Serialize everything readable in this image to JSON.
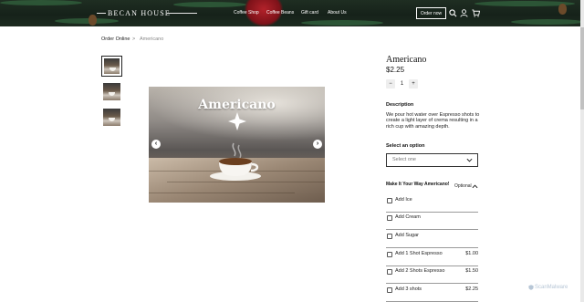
{
  "header": {
    "logo": "BECAN HOUSE",
    "nav": [
      {
        "label": "Coffee Shop"
      },
      {
        "label": "Coffee Beans"
      },
      {
        "label": "Gift card"
      },
      {
        "label": "About Us"
      }
    ],
    "order_button": "Order now",
    "icons": [
      "search-icon",
      "account-icon",
      "cart-icon"
    ]
  },
  "breadcrumb": {
    "items": [
      "Order Online",
      "Americano"
    ],
    "separator": ">"
  },
  "gallery": {
    "thumbnail_count": 3,
    "hero_caption": "Americano"
  },
  "product": {
    "title": "Americano",
    "price": "$2.25",
    "quantity": "1",
    "qty_minus": "−",
    "qty_plus": "+",
    "description_label": "Description",
    "description": "We pour hot water over Espresso shots to create a light layer of crema resulting in a rich cup with amazing depth.",
    "select_label": "Select an option",
    "select_value": "Select one",
    "modifier_title": "Make It Your Way Americano!",
    "modifier_optional": "Optional",
    "options": [
      {
        "name": "Add Ice",
        "price": ""
      },
      {
        "name": "Add Cream",
        "price": ""
      },
      {
        "name": "Add Sugar",
        "price": ""
      },
      {
        "name": "Add 1 Shot Espresso",
        "price": "$1.00"
      },
      {
        "name": "Add 2 Shots Espresso",
        "price": "$1.50"
      },
      {
        "name": "Add 3 shots",
        "price": "$2.25"
      }
    ]
  },
  "watermark": "ScanMalware",
  "colors": {
    "header_bg": "#1f2e22",
    "ribbon": "#b3222a",
    "text": "#222222"
  }
}
